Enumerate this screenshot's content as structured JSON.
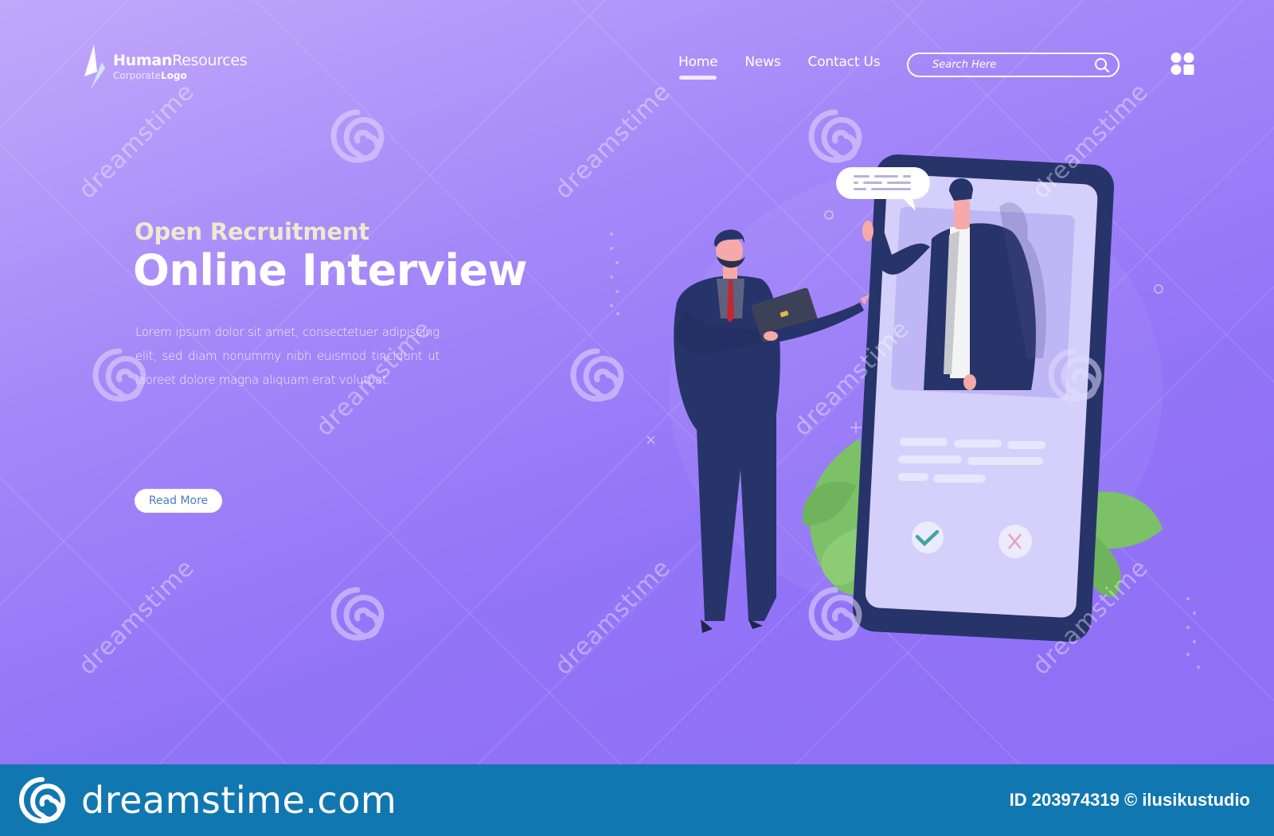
{
  "logo": {
    "title_bold": "Human",
    "title_light": "Resources",
    "sub_light": "Corporate",
    "sub_bold": "Logo"
  },
  "nav": {
    "items": [
      {
        "label": "Home",
        "active": true
      },
      {
        "label": "News",
        "active": false
      },
      {
        "label": "Contact Us",
        "active": false
      }
    ]
  },
  "search": {
    "placeholder": "Search Here",
    "icon": "search-icon"
  },
  "header_icons": {
    "apps": "apps-grid-icon"
  },
  "hero": {
    "eyebrow": "Open Recruitment",
    "headline": "Online Interview",
    "body": "Lorem ipsum dolor sit amet, consectetuer adipiscing elit, sed diam nonummy nibh euismod tincidunt ut laoreet dolore magna aliquam erat volutpat.",
    "cta_label": "Read More"
  },
  "illustration": {
    "accept_icon": "checkmark-icon",
    "reject_icon": "x-icon",
    "chat_bubble_icon": "speech-bubble-icon"
  },
  "colors": {
    "gradient_top": "#c2a8fb",
    "gradient_bottom": "#8f6ff6",
    "navy": "#27346a",
    "leaf_green": "#7cc168",
    "cta_text": "#4d7ac8",
    "footer_bg": "#1177b1",
    "eyebrow_text": "#efe9cf"
  },
  "watermark": {
    "text": "dreamstime"
  },
  "footer": {
    "brand": "dreamstime.com",
    "credit": "ID 203974319 © ilusikustudio"
  }
}
